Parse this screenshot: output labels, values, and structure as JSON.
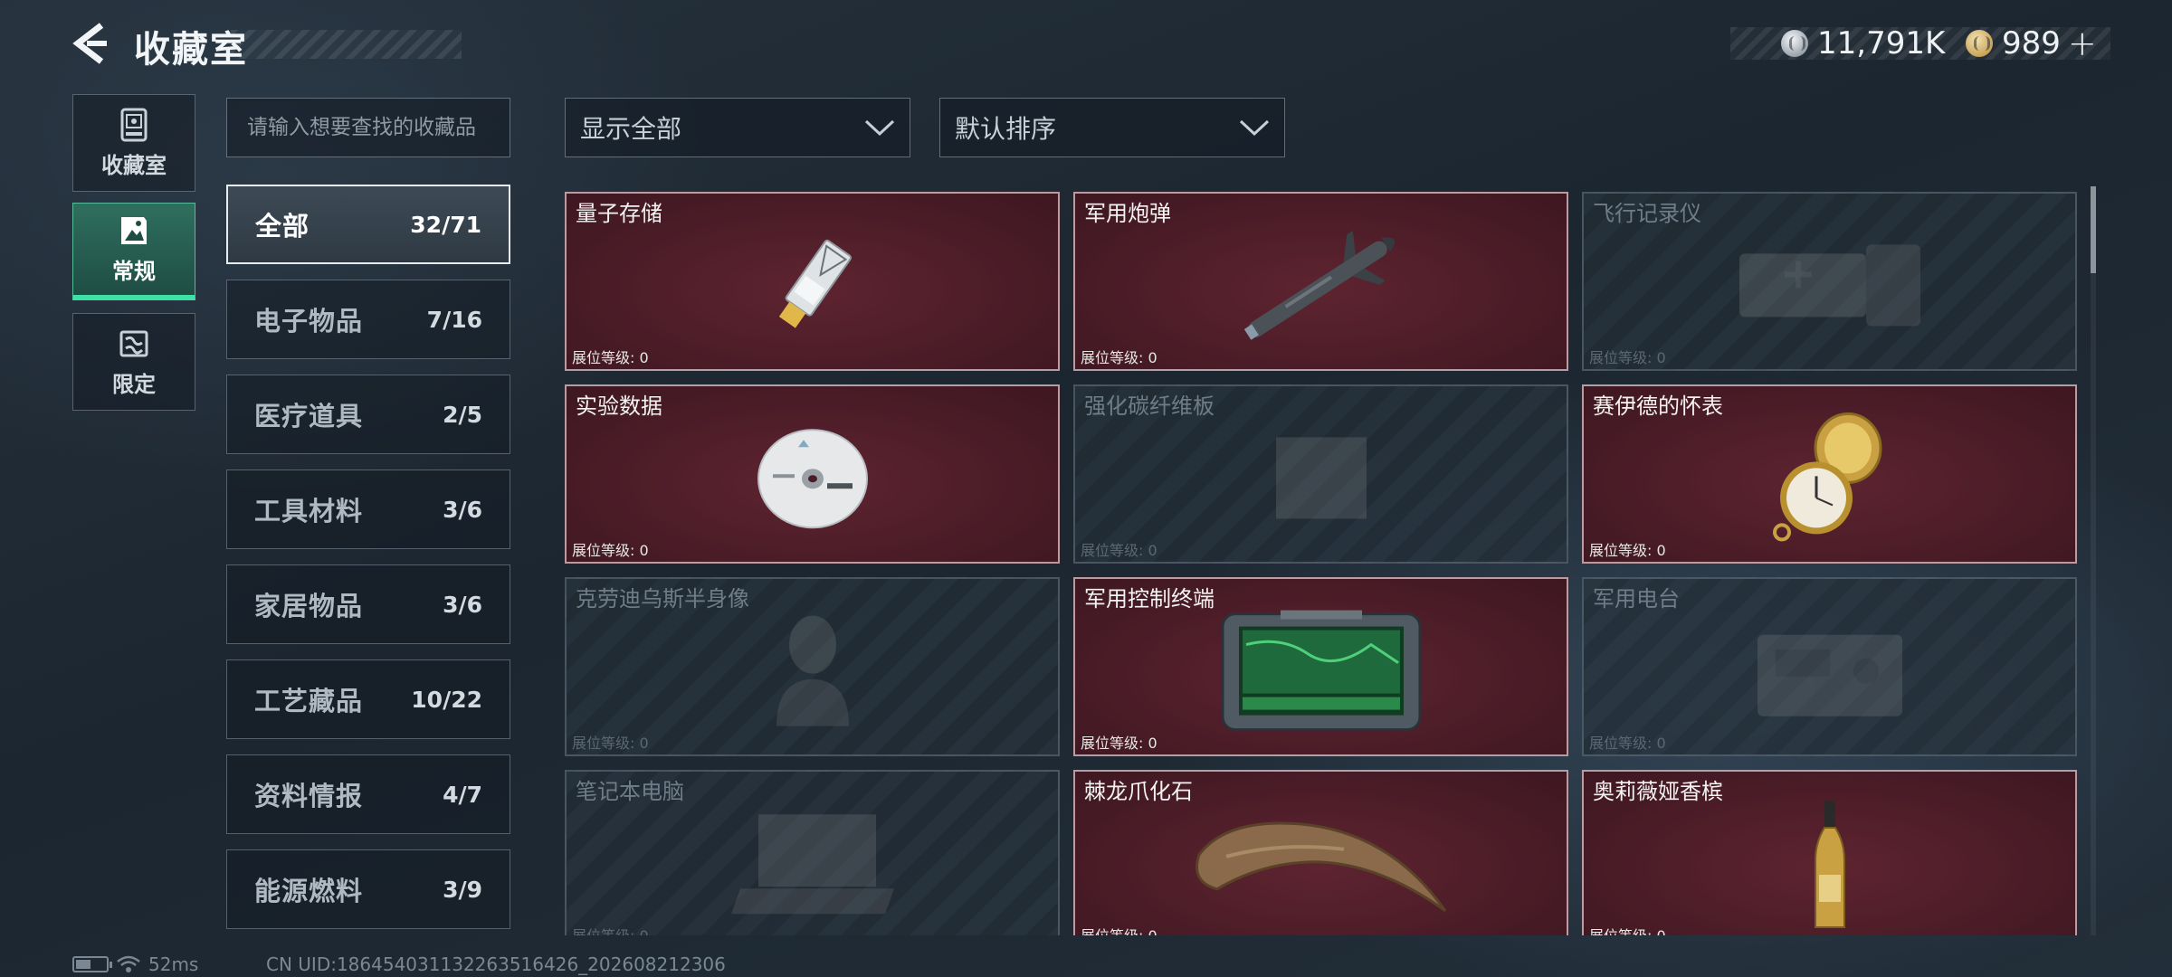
{
  "header": {
    "title": "收藏室",
    "currencies": [
      {
        "icon": "silver-coin-icon",
        "value": "11,791K"
      },
      {
        "icon": "gold-coin-icon",
        "value": "989"
      }
    ]
  },
  "rail": [
    {
      "label": "收藏室",
      "icon": "vault-icon",
      "active": false
    },
    {
      "label": "常规",
      "icon": "picture-frame-icon",
      "active": true
    },
    {
      "label": "限定",
      "icon": "limited-icon",
      "active": false
    }
  ],
  "search": {
    "placeholder": "请输入想要查找的收藏品"
  },
  "categories": [
    {
      "label": "全部",
      "count": "32/71",
      "active": true
    },
    {
      "label": "电子物品",
      "count": "7/16"
    },
    {
      "label": "医疗道具",
      "count": "2/5"
    },
    {
      "label": "工具材料",
      "count": "3/6"
    },
    {
      "label": "家居物品",
      "count": "3/6"
    },
    {
      "label": "工艺藏品",
      "count": "10/22"
    },
    {
      "label": "资料情报",
      "count": "4/7"
    },
    {
      "label": "能源燃料",
      "count": "3/9"
    }
  ],
  "filters": {
    "show": "显示全部",
    "sort": "默认排序"
  },
  "level_label": "展位等级: 0",
  "items": [
    {
      "name": "量子存储",
      "owned": true,
      "art": "usb-drive"
    },
    {
      "name": "军用炮弹",
      "owned": true,
      "art": "missile"
    },
    {
      "name": "飞行记录仪",
      "owned": false,
      "art": "recorder"
    },
    {
      "name": "实验数据",
      "owned": true,
      "art": "disc"
    },
    {
      "name": "强化碳纤维板",
      "owned": false,
      "art": "panel"
    },
    {
      "name": "赛伊德的怀表",
      "owned": true,
      "art": "pocket-watch"
    },
    {
      "name": "克劳迪乌斯半身像",
      "owned": false,
      "art": "bust"
    },
    {
      "name": "军用控制终端",
      "owned": true,
      "art": "terminal"
    },
    {
      "name": "军用电台",
      "owned": false,
      "art": "radio"
    },
    {
      "name": "笔记本电脑",
      "owned": false,
      "art": "laptop"
    },
    {
      "name": "棘龙爪化石",
      "owned": true,
      "art": "claw-fossil"
    },
    {
      "name": "奥莉薇娅香槟",
      "owned": true,
      "art": "champagne"
    }
  ],
  "status": {
    "ping": "52ms",
    "uid": "CN UID:1864540311322635164​26_202608212306"
  },
  "colors": {
    "accent": "#3fe0a6",
    "owned_card": "#4a1c27"
  }
}
